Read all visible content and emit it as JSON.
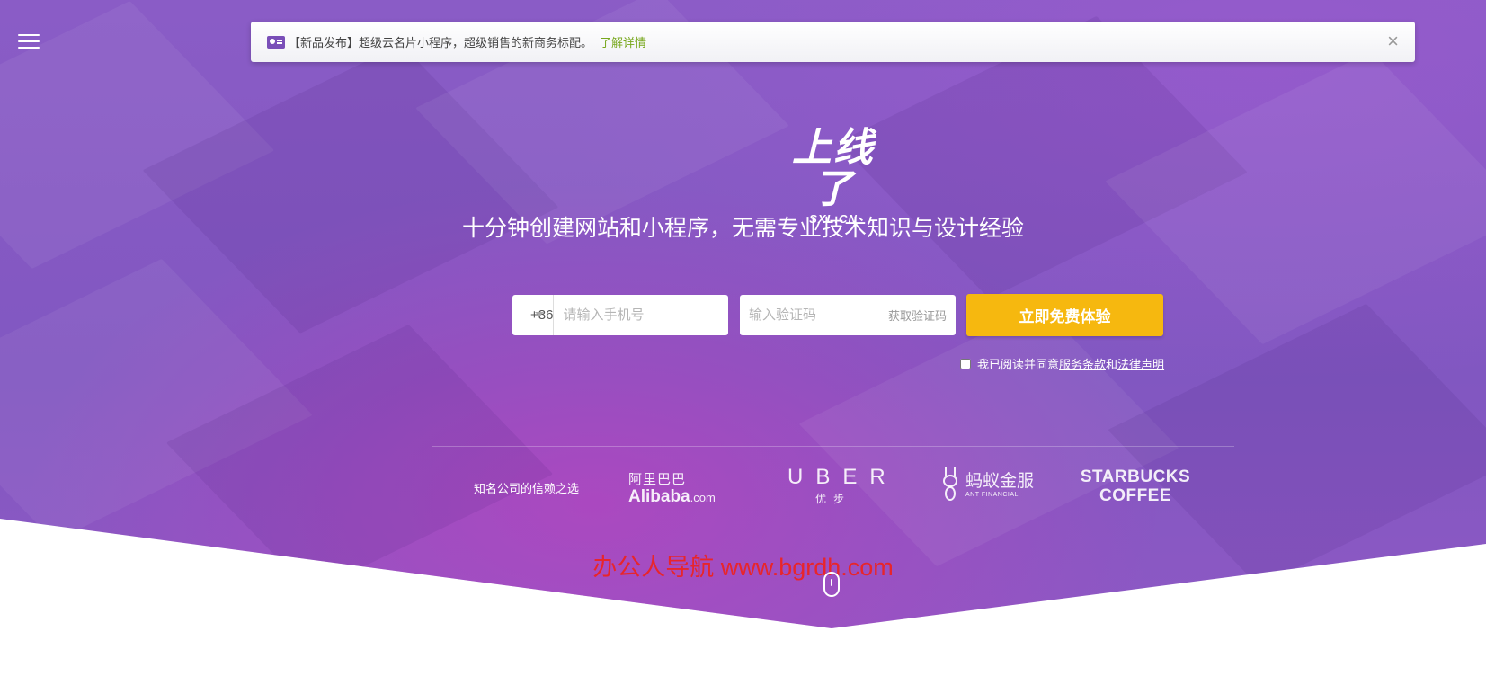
{
  "notice": {
    "icon": "business-card-icon",
    "text": "【新品发布】超级云名片小程序，超级销售的新商务标配。",
    "link": "了解详情",
    "close": "×"
  },
  "logo": {
    "main": "上线了",
    "sub": "SXL.CN"
  },
  "tagline": "十分钟创建网站和小程序，无需专业技术知识与设计经验",
  "signup": {
    "country_code": "+86",
    "phone_placeholder": "请输入手机号",
    "code_placeholder": "输入验证码",
    "get_code": "获取验证码",
    "cta": "立即免费体验"
  },
  "agreement": {
    "prefix": "我已阅读并同意",
    "terms": "服务条款",
    "and": "和",
    "legal": "法律声明"
  },
  "trusted": {
    "label": "知名公司的信赖之选",
    "alibaba_cn": "阿里巴巴",
    "alibaba_en": "Alibaba",
    "alibaba_suffix": ".com",
    "uber_en": "UBER",
    "uber_cn": "优步",
    "ant_cn": "蚂蚁金服",
    "ant_en": "ANT FINANCIAL",
    "starbucks_1": "STARBUCKS",
    "starbucks_2": "COFFEE"
  },
  "watermark": "办公人导航 www.bgrdh.com",
  "colors": {
    "hero_purple": "#8a5cc6",
    "cta_yellow": "#f6b80f",
    "link_green": "#78a81e",
    "watermark_red": "#e8252b"
  }
}
